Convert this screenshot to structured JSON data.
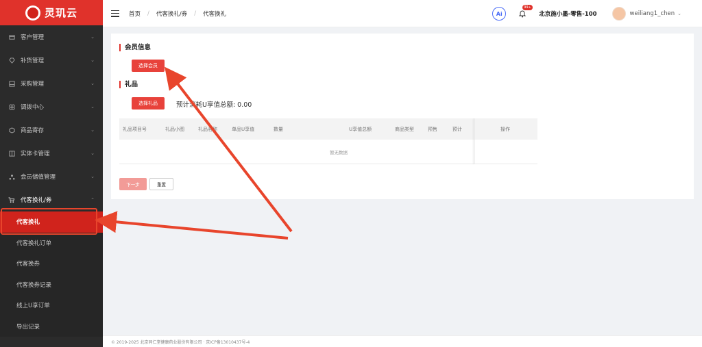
{
  "brand": {
    "name": "灵玑云"
  },
  "sidebar": {
    "items": [
      {
        "label": "客户管理",
        "icon": "card-icon"
      },
      {
        "label": "补货管理",
        "icon": "diamond-icon"
      },
      {
        "label": "采购管理",
        "icon": "inbox-icon"
      },
      {
        "label": "调拨中心",
        "icon": "grid-icon"
      },
      {
        "label": "商品寄存",
        "icon": "box-icon"
      },
      {
        "label": "实体卡管理",
        "icon": "book-icon"
      },
      {
        "label": "会员储值管理",
        "icon": "users-icon"
      },
      {
        "label": "代客换礼/券",
        "icon": "cart-icon"
      }
    ],
    "sub_items": [
      {
        "label": "代客换礼",
        "active": true
      },
      {
        "label": "代客换礼订单"
      },
      {
        "label": "代客换券"
      },
      {
        "label": "代客换券记录"
      },
      {
        "label": "线上U享订单"
      },
      {
        "label": "导出记录"
      }
    ]
  },
  "header": {
    "breadcrumb": [
      "首页",
      "代客换礼/券",
      "代客换礼"
    ],
    "ai_label": "Ai",
    "notification_count": "99+",
    "store_name": "北京施小墨-零售-100",
    "user_name": "weiliang1_chen"
  },
  "member_section": {
    "title": "会员信息",
    "select_button": "选择会员"
  },
  "gift_section": {
    "title": "礼品",
    "select_button": "选择礼品",
    "estimate_text": "预计消耗U享值总额: 0.00"
  },
  "table": {
    "columns": [
      "礼品项目号",
      "礼品小图",
      "礼品名称",
      "单品U享值",
      "数量",
      "U享值总额",
      "商品类型",
      "预售",
      "预计",
      "操作"
    ],
    "empty_text": "暂无数据"
  },
  "actions": {
    "next": "下一步",
    "reset": "重置"
  },
  "footer": {
    "copyright": "© 2019-2025 北京同仁堂健康药业股份有限公司 · 京ICP备13010437号-4"
  },
  "colors": {
    "brand_red": "#e0322b",
    "sidebar_bg": "#2b2b2b",
    "annotation_arrow": "#e8452c"
  }
}
